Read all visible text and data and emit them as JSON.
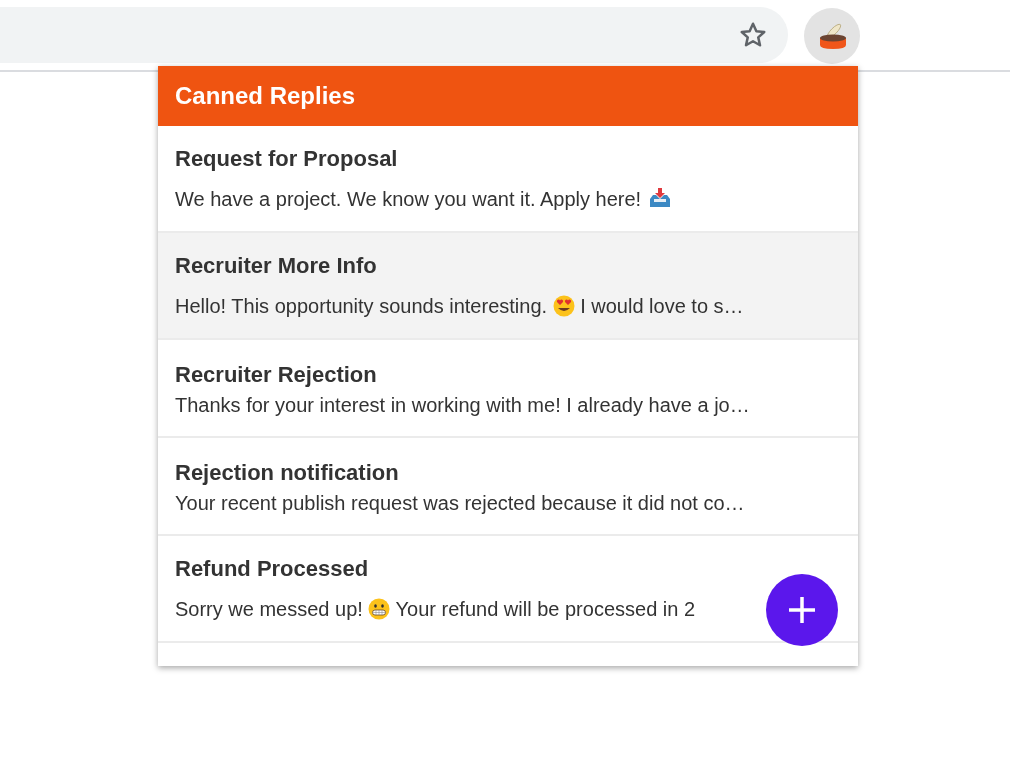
{
  "popup": {
    "title": "Canned Replies"
  },
  "replies": [
    {
      "title": "Request for Proposal",
      "highlighted": false,
      "preview": [
        {
          "kind": "text",
          "text": "We have a project. We know you want it. Apply here! "
        },
        {
          "kind": "inbox-emoji"
        }
      ]
    },
    {
      "title": "Recruiter More Info",
      "highlighted": true,
      "preview": [
        {
          "kind": "text",
          "text": "Hello! This opportunity sounds interesting. "
        },
        {
          "kind": "heart-eyes-emoji"
        },
        {
          "kind": "text",
          "text": " I would love to s…"
        }
      ]
    },
    {
      "title": "Recruiter Rejection",
      "highlighted": false,
      "preview": [
        {
          "kind": "text",
          "text": "Thanks for your interest in working with me! I already have a jo…"
        }
      ]
    },
    {
      "title": "Rejection notification",
      "highlighted": false,
      "preview": [
        {
          "kind": "text",
          "text": "Your recent publish request was rejected because it did not co…"
        }
      ]
    },
    {
      "title": "Refund Processed",
      "highlighted": false,
      "preview": [
        {
          "kind": "text",
          "text": "Sorry we messed up! "
        },
        {
          "kind": "grimace-emoji"
        },
        {
          "kind": "text",
          "text": " Your refund will be processed in 2"
        }
      ]
    }
  ]
}
